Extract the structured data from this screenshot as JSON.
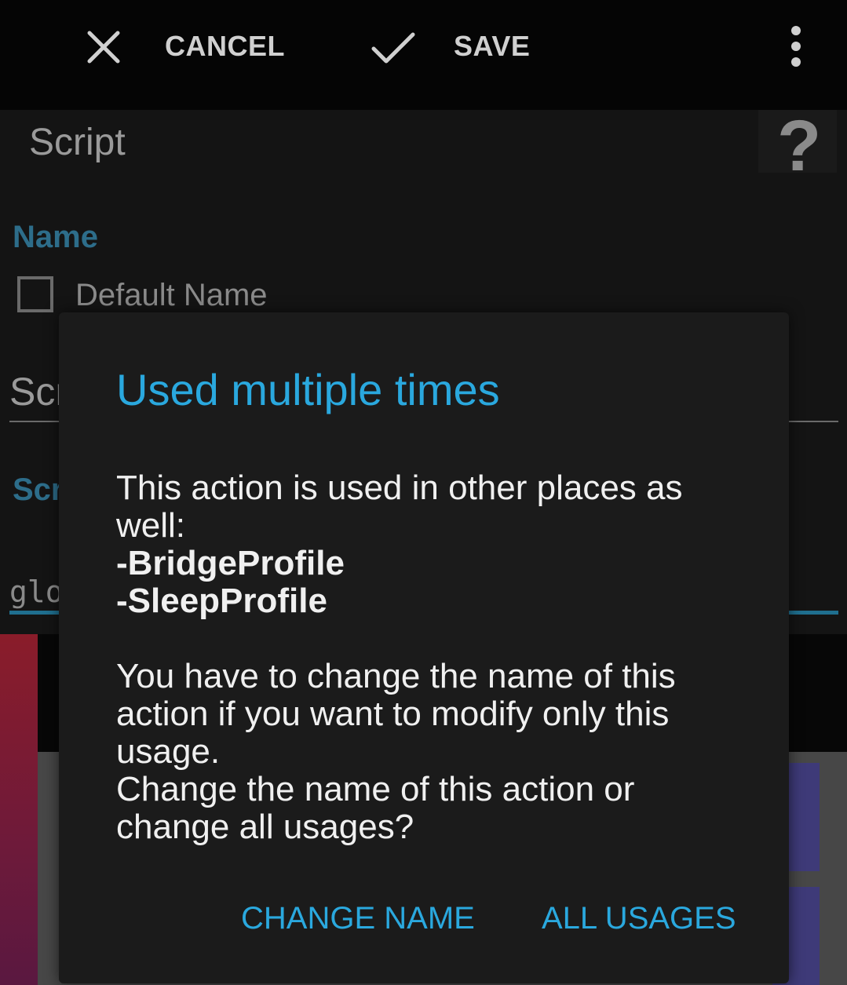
{
  "toolbar": {
    "cancel_label": "CANCEL",
    "save_label": "SAVE",
    "cancel_icon": "close-icon",
    "save_icon": "check-icon",
    "overflow_icon": "more-vertical-icon"
  },
  "screen": {
    "title": "Script",
    "help_glyph": "?",
    "name_section_label": "Name",
    "default_name_label": "Default Name",
    "field_partial_text": "Scr",
    "second_section_partial": "Scr",
    "code_partial_text": "glo"
  },
  "dialog": {
    "title": "Used multiple times",
    "line1": "This action is used in other places as well:",
    "usage1": "-BridgeProfile",
    "usage2": "-SleepProfile",
    "line2": "You have to change the name of this action if you want to modify only this usage.",
    "line3": "Change the name of this action or change all usages?",
    "change_name_label": "CHANGE NAME",
    "all_usages_label": "ALL USAGES"
  },
  "colors": {
    "accent": "#2aa8de",
    "section_label": "#2d6d8a",
    "dialog_bg": "#1b1b1b"
  }
}
